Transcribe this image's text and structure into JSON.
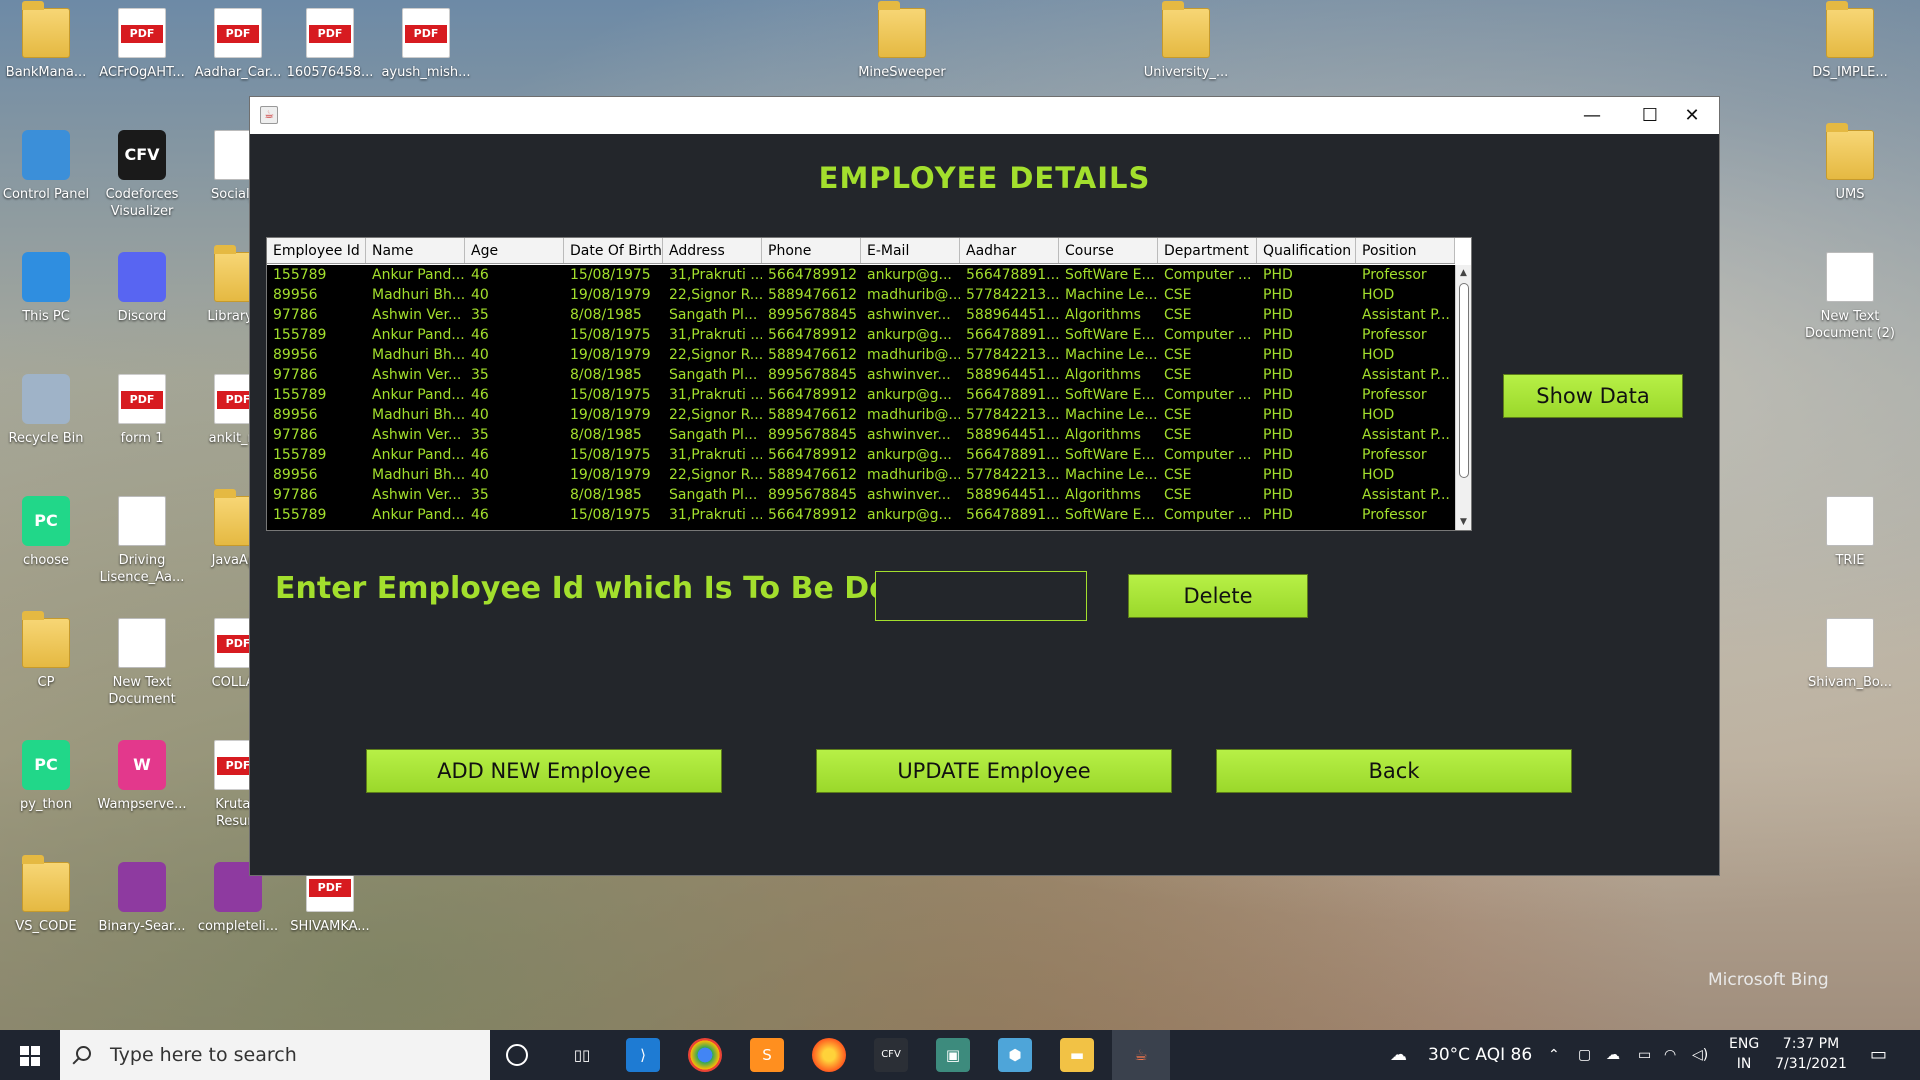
{
  "desktop": {
    "icons_left": [
      {
        "label": "BankMana...",
        "kind": "folder"
      },
      {
        "label": "ACFrOgAHT...",
        "kind": "pdf"
      },
      {
        "label": "Aadhar_Car...",
        "kind": "pdf"
      },
      {
        "label": "160576458...",
        "kind": "pdf"
      },
      {
        "label": "ayush_mish...",
        "kind": "pdf"
      },
      {
        "label": "MineSweeper",
        "kind": "folder"
      },
      {
        "label": "University_...",
        "kind": "folder"
      },
      {
        "label": "DS_IMPLE...",
        "kind": "folder"
      },
      {
        "label": "Control Panel",
        "kind": "app"
      },
      {
        "label": "Codeforces Visualizer",
        "kind": "app",
        "glyph": "CFV"
      },
      {
        "label": "Social_A",
        "kind": "doc"
      },
      {
        "label": "UMS",
        "kind": "folder"
      },
      {
        "label": "This PC",
        "kind": "app"
      },
      {
        "label": "Discord",
        "kind": "app"
      },
      {
        "label": "Library-M",
        "kind": "folder"
      },
      {
        "label": "New Text Document (2)",
        "kind": "doc"
      },
      {
        "label": "Recycle Bin",
        "kind": "app"
      },
      {
        "label": "form 1",
        "kind": "pdf"
      },
      {
        "label": "ankit_res",
        "kind": "pdf"
      },
      {
        "label": "choose",
        "kind": "app",
        "glyph": "PC"
      },
      {
        "label": "Driving Lisence_Aa...",
        "kind": "doc"
      },
      {
        "label": "JavaApp",
        "kind": "folder"
      },
      {
        "label": "TRIE",
        "kind": "doc"
      },
      {
        "label": "CP",
        "kind": "folder"
      },
      {
        "label": "New Text Document",
        "kind": "doc"
      },
      {
        "label": "COLLAG",
        "kind": "pdf"
      },
      {
        "label": "Shivam_Bo...",
        "kind": "doc"
      },
      {
        "label": "py_thon",
        "kind": "app",
        "glyph": "PC"
      },
      {
        "label": "Wampserve...",
        "kind": "app",
        "glyph": "W"
      },
      {
        "label": "Krutart Resum",
        "kind": "pdf"
      },
      {
        "label": "VS_CODE",
        "kind": "folder"
      },
      {
        "label": "Binary-Sear...",
        "kind": "app"
      },
      {
        "label": "completeli...",
        "kind": "app"
      },
      {
        "label": "SHIVAMKA...",
        "kind": "pdf"
      }
    ],
    "pdf_badge": "PDF",
    "watermark": "Microsoft Bing"
  },
  "window": {
    "title": "EMPLOYEE DETAILS",
    "controls": {
      "minimize": "—",
      "maximize": "☐",
      "close": "✕"
    },
    "table": {
      "columns": [
        "Employee Id",
        "Name",
        "Age",
        "Date Of Birth",
        "Address",
        "Phone",
        "E-Mail",
        "Aadhar",
        "Course",
        "Department",
        "Qualification",
        "Position"
      ],
      "rows": [
        [
          "155789",
          "Ankur Pand...",
          "46",
          "15/08/1975",
          "31,Prakruti ...",
          "5664789912",
          "ankurp@g...",
          "566478891...",
          "SoftWare E...",
          "Computer ...",
          "PHD",
          "Professor"
        ],
        [
          "89956",
          "Madhuri Bh...",
          "40",
          "19/08/1979",
          "22,Signor R...",
          "5889476612",
          "madhurib@...",
          "577842213...",
          "Machine Le...",
          "CSE",
          "PHD",
          "HOD"
        ],
        [
          "97786",
          "Ashwin Ver...",
          "35",
          "8/08/1985",
          "Sangath Pl...",
          "8995678845",
          "ashwinver...",
          "588964451...",
          "Algorithms",
          "CSE",
          "PHD",
          "Assistant P..."
        ],
        [
          "155789",
          "Ankur Pand...",
          "46",
          "15/08/1975",
          "31,Prakruti ...",
          "5664789912",
          "ankurp@g...",
          "566478891...",
          "SoftWare E...",
          "Computer ...",
          "PHD",
          "Professor"
        ],
        [
          "89956",
          "Madhuri Bh...",
          "40",
          "19/08/1979",
          "22,Signor R...",
          "5889476612",
          "madhurib@...",
          "577842213...",
          "Machine Le...",
          "CSE",
          "PHD",
          "HOD"
        ],
        [
          "97786",
          "Ashwin Ver...",
          "35",
          "8/08/1985",
          "Sangath Pl...",
          "8995678845",
          "ashwinver...",
          "588964451...",
          "Algorithms",
          "CSE",
          "PHD",
          "Assistant P..."
        ],
        [
          "155789",
          "Ankur Pand...",
          "46",
          "15/08/1975",
          "31,Prakruti ...",
          "5664789912",
          "ankurp@g...",
          "566478891...",
          "SoftWare E...",
          "Computer ...",
          "PHD",
          "Professor"
        ],
        [
          "89956",
          "Madhuri Bh...",
          "40",
          "19/08/1979",
          "22,Signor R...",
          "5889476612",
          "madhurib@...",
          "577842213...",
          "Machine Le...",
          "CSE",
          "PHD",
          "HOD"
        ],
        [
          "97786",
          "Ashwin Ver...",
          "35",
          "8/08/1985",
          "Sangath Pl...",
          "8995678845",
          "ashwinver...",
          "588964451...",
          "Algorithms",
          "CSE",
          "PHD",
          "Assistant P..."
        ],
        [
          "155789",
          "Ankur Pand...",
          "46",
          "15/08/1975",
          "31,Prakruti ...",
          "5664789912",
          "ankurp@g...",
          "566478891...",
          "SoftWare E...",
          "Computer ...",
          "PHD",
          "Professor"
        ],
        [
          "89956",
          "Madhuri Bh...",
          "40",
          "19/08/1979",
          "22,Signor R...",
          "5889476612",
          "madhurib@...",
          "577842213...",
          "Machine Le...",
          "CSE",
          "PHD",
          "HOD"
        ],
        [
          "97786",
          "Ashwin Ver...",
          "35",
          "8/08/1985",
          "Sangath Pl...",
          "8995678845",
          "ashwinver...",
          "588964451...",
          "Algorithms",
          "CSE",
          "PHD",
          "Assistant P..."
        ],
        [
          "155789",
          "Ankur Pand...",
          "46",
          "15/08/1975",
          "31,Prakruti ...",
          "5664789912",
          "ankurp@g...",
          "566478891...",
          "SoftWare E...",
          "Computer ...",
          "PHD",
          "Professor"
        ]
      ]
    },
    "show_data_label": "Show Data",
    "delete_prompt": "Enter Employee Id which Is To Be Deleted:",
    "delete_input_value": "",
    "delete_label": "Delete",
    "add_label": "ADD NEW Employee",
    "update_label": "UPDATE Employee",
    "back_label": "Back",
    "accent": "#a3df2d",
    "background": "#23262b"
  },
  "taskbar": {
    "search_placeholder": "Type here to search",
    "weather": "30°C  AQI 86",
    "lang_top": "ENG",
    "lang_bottom": "IN",
    "time": "7:37 PM",
    "date": "7/31/2021"
  }
}
